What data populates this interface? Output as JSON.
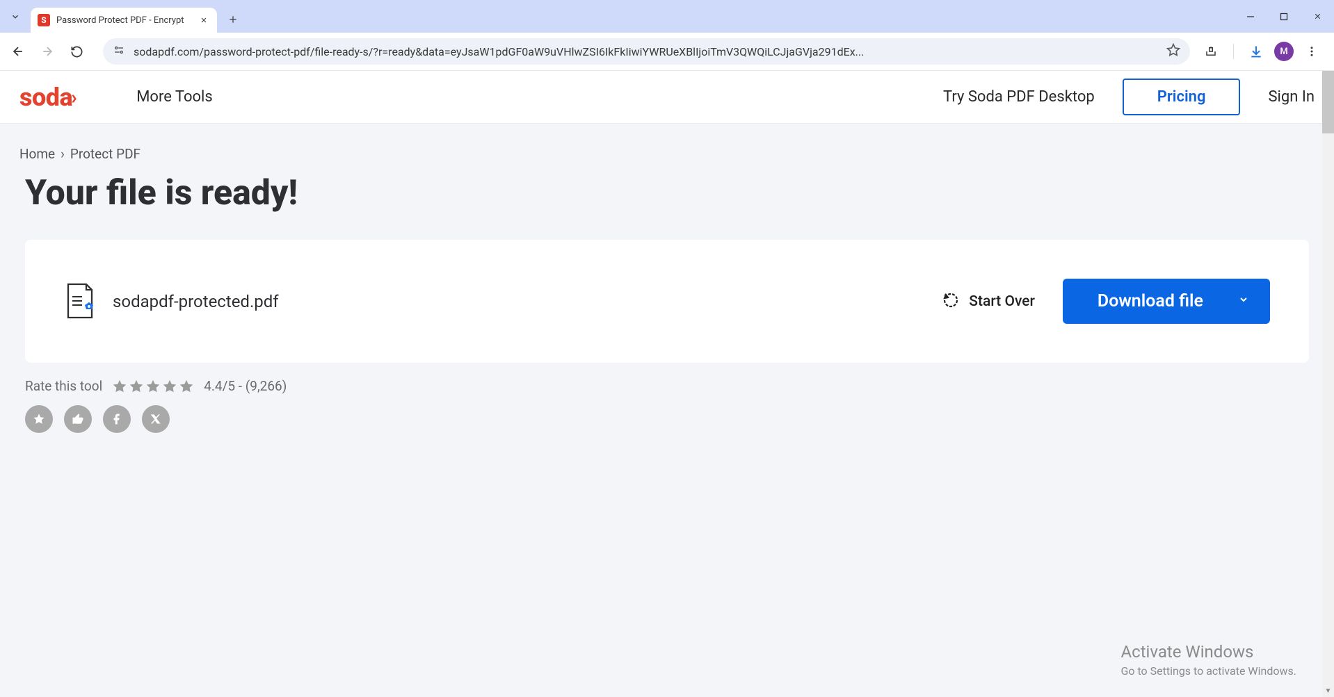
{
  "browser": {
    "tab_title": "Password Protect PDF - Encrypt",
    "url": "sodapdf.com/password-protect-pdf/file-ready-s/?r=ready&data=eyJsaW1pdGF0aW9uVHlwZSI6IkFkIiwiYWRUeXBlIjoiTmV3QWQiLCJjaGVja291dEx...",
    "avatar_initial": "M"
  },
  "header": {
    "logo_text": "soda",
    "more_tools": "More Tools",
    "try_desktop": "Try Soda PDF Desktop",
    "pricing": "Pricing",
    "sign_in": "Sign In"
  },
  "breadcrumb": {
    "home": "Home",
    "current": "Protect PDF"
  },
  "page": {
    "title": "Your file is ready!"
  },
  "file": {
    "name": "sodapdf-protected.pdf",
    "start_over": "Start Over",
    "download": "Download file"
  },
  "rating": {
    "label": "Rate this tool",
    "score": "4.4/5 - (9,266)"
  },
  "watermark": {
    "line1": "Activate Windows",
    "line2": "Go to Settings to activate Windows."
  }
}
